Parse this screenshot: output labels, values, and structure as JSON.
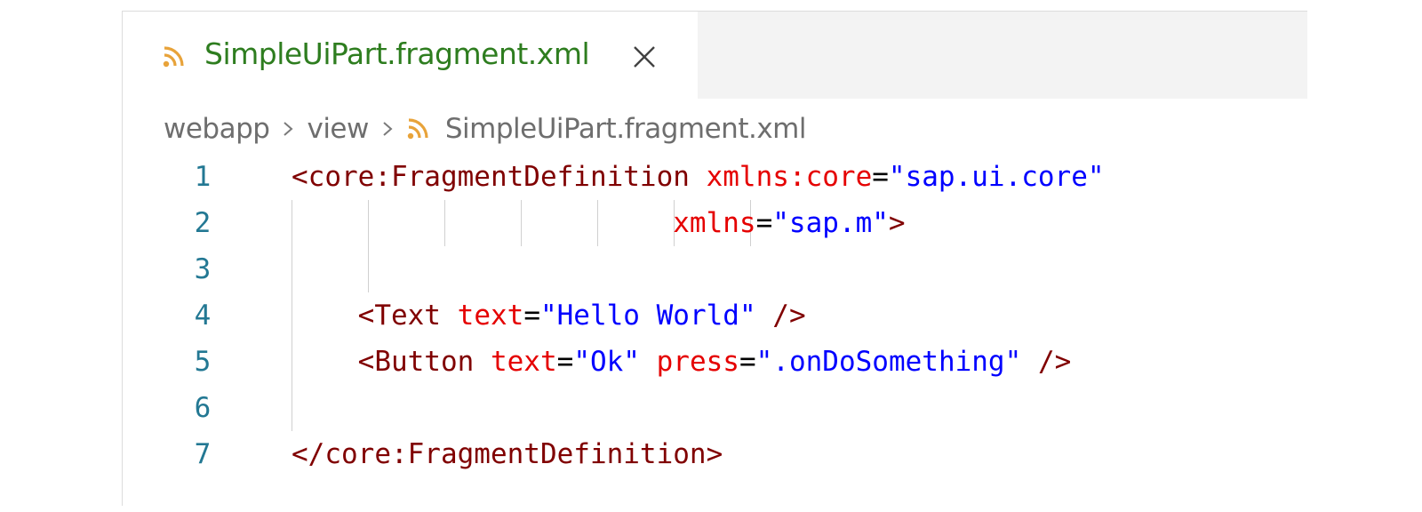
{
  "tab": {
    "file_icon": "rss-xml-icon",
    "label": "SimpleUiPart.fragment.xml",
    "close_glyph": "close-icon"
  },
  "breadcrumb": {
    "items": [
      "webapp",
      "view"
    ],
    "file_icon": "rss-xml-icon",
    "file": "SimpleUiPart.fragment.xml"
  },
  "editor": {
    "lines": [
      {
        "number": "1",
        "tokens": [
          {
            "cls": "tag",
            "text": "<core:FragmentDefinition"
          },
          {
            "cls": "eq",
            "text": " "
          },
          {
            "cls": "attr",
            "text": "xmlns:core"
          },
          {
            "cls": "eq",
            "text": "="
          },
          {
            "cls": "val",
            "text": "\"sap.ui.core\""
          }
        ]
      },
      {
        "number": "2",
        "tokens": [
          {
            "cls": "eq",
            "text": "                       "
          },
          {
            "cls": "attr",
            "text": "xmlns"
          },
          {
            "cls": "eq",
            "text": "="
          },
          {
            "cls": "val",
            "text": "\"sap.m\""
          },
          {
            "cls": "tag",
            "text": ">"
          }
        ]
      },
      {
        "number": "3",
        "tokens": []
      },
      {
        "number": "4",
        "tokens": [
          {
            "cls": "eq",
            "text": "    "
          },
          {
            "cls": "tag",
            "text": "<Text"
          },
          {
            "cls": "eq",
            "text": " "
          },
          {
            "cls": "attr",
            "text": "text"
          },
          {
            "cls": "eq",
            "text": "="
          },
          {
            "cls": "val",
            "text": "\"Hello World\""
          },
          {
            "cls": "eq",
            "text": " "
          },
          {
            "cls": "tag",
            "text": "/>"
          }
        ]
      },
      {
        "number": "5",
        "tokens": [
          {
            "cls": "eq",
            "text": "    "
          },
          {
            "cls": "tag",
            "text": "<Button"
          },
          {
            "cls": "eq",
            "text": " "
          },
          {
            "cls": "attr",
            "text": "text"
          },
          {
            "cls": "eq",
            "text": "="
          },
          {
            "cls": "val",
            "text": "\"Ok\""
          },
          {
            "cls": "eq",
            "text": " "
          },
          {
            "cls": "attr",
            "text": "press"
          },
          {
            "cls": "eq",
            "text": "="
          },
          {
            "cls": "val",
            "text": "\".onDoSomething\""
          },
          {
            "cls": "eq",
            "text": " "
          },
          {
            "cls": "tag",
            "text": "/>"
          }
        ]
      },
      {
        "number": "6",
        "tokens": []
      },
      {
        "number": "7",
        "tokens": [
          {
            "cls": "tag",
            "text": "</core:FragmentDefinition>"
          }
        ]
      }
    ]
  },
  "colors": {
    "tab_label": "#2e7d1f",
    "line_number": "#237893",
    "tag": "#800000",
    "attribute": "#e50000",
    "value": "#0000ff",
    "file_icon": "#e8a33a"
  }
}
